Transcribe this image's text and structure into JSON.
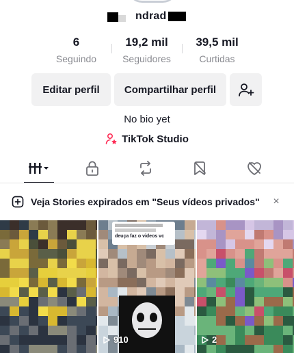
{
  "profile": {
    "name_partial": "ndrad"
  },
  "stats": [
    {
      "value": "6",
      "label": "Seguindo"
    },
    {
      "value": "19,2 mil",
      "label": "Seguidores"
    },
    {
      "value": "39,5 mil",
      "label": "Curtidas"
    }
  ],
  "buttons": {
    "edit_label": "Editar perfil",
    "share_label": "Compartilhar perfil",
    "add_friend_icon": "add-user-icon"
  },
  "bio": "No bio yet",
  "studio": {
    "label": "TikTok Studio",
    "accent": "#fe2c55"
  },
  "tabs": [
    {
      "icon": "videos-grid-icon",
      "active": true
    },
    {
      "icon": "lock-icon",
      "active": false
    },
    {
      "icon": "repost-icon",
      "active": false
    },
    {
      "icon": "favorites-icon",
      "active": false
    },
    {
      "icon": "liked-icon",
      "active": false
    }
  ],
  "banner": {
    "text": "Veja Stories expirados em \"Seus vídeos privados\"",
    "icon": "add-story-icon",
    "close": "×"
  },
  "videos": [
    {
      "views": ""
    },
    {
      "views": "910",
      "overlay_text": "deuça faz o videos vc"
    },
    {
      "views": "2"
    }
  ]
}
